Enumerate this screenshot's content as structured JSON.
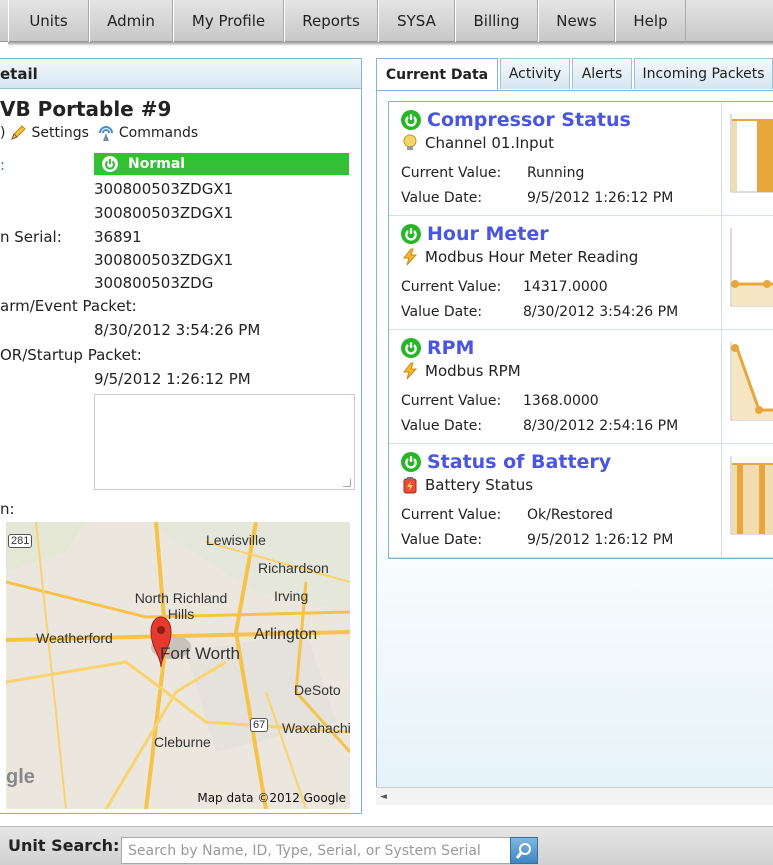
{
  "nav": {
    "items": [
      "Units",
      "Admin",
      "My Profile",
      "Reports",
      "SYSA",
      "Billing",
      "News",
      "Help"
    ]
  },
  "detail": {
    "header": "etail",
    "unit_name": "VB Portable #9",
    "link_partial": ")",
    "settings_label": "Settings",
    "commands_label": "Commands",
    "status": "Normal",
    "rows": [
      {
        "label": ":",
        "value": ""
      },
      {
        "label": "",
        "value": "300800503ZDGX1"
      },
      {
        "label": "",
        "value": "300800503ZDGX1"
      },
      {
        "label": "n Serial:",
        "value": "36891"
      },
      {
        "label": "",
        "value": "300800503ZDGX1"
      },
      {
        "label": "",
        "value": "300800503ZDG"
      }
    ],
    "alarm_label": "arm/Event Packet:",
    "alarm_value": "8/30/2012 3:54:26 PM",
    "por_label": "OR/Startup Packet:",
    "por_value": "9/5/2012 1:26:12 PM",
    "location_label": "n:",
    "map": {
      "places": [
        "Lewisville",
        "Richardson",
        "North Richland Hills",
        "Irving",
        "Weatherford",
        "Arlington",
        "Fort Worth",
        "DeSoto",
        "Waxahachie",
        "Cleburne"
      ],
      "highways": [
        "281",
        "67"
      ],
      "copyright": "Map data ©2012 Google",
      "logo": "gle"
    }
  },
  "tabs": [
    "Current Data",
    "Activity",
    "Alerts",
    "Incoming Packets"
  ],
  "cards": [
    {
      "title": "Compressor Status",
      "subtitle": "Channel 01.Input",
      "sub_icon": "bulb-icon",
      "current_label": "Current Value:",
      "current_value": "Running",
      "date_label": "Value Date:",
      "date_value": "9/5/2012 1:26:12 PM"
    },
    {
      "title": "Hour Meter",
      "subtitle": "Modbus Hour Meter Reading",
      "sub_icon": "lightning-icon",
      "current_label": "Current Value:",
      "current_value": "14317.0000",
      "date_label": "Value Date:",
      "date_value": "8/30/2012 3:54:26 PM"
    },
    {
      "title": "RPM",
      "subtitle": "Modbus RPM",
      "sub_icon": "lightning-icon",
      "current_label": "Current Value:",
      "current_value": "1368.0000",
      "date_label": "Value Date:",
      "date_value": "8/30/2012 2:54:16 PM"
    },
    {
      "title": "Status of Battery",
      "subtitle": "Battery Status",
      "sub_icon": "battery-icon",
      "current_label": "Current Value:",
      "current_value": "Ok/Restored",
      "date_label": "Value Date:",
      "date_value": "9/5/2012 1:26:12 PM"
    }
  ],
  "search": {
    "label": "Unit Search:",
    "placeholder": "Search by Name, ID, Type, Serial, or System Serial"
  }
}
